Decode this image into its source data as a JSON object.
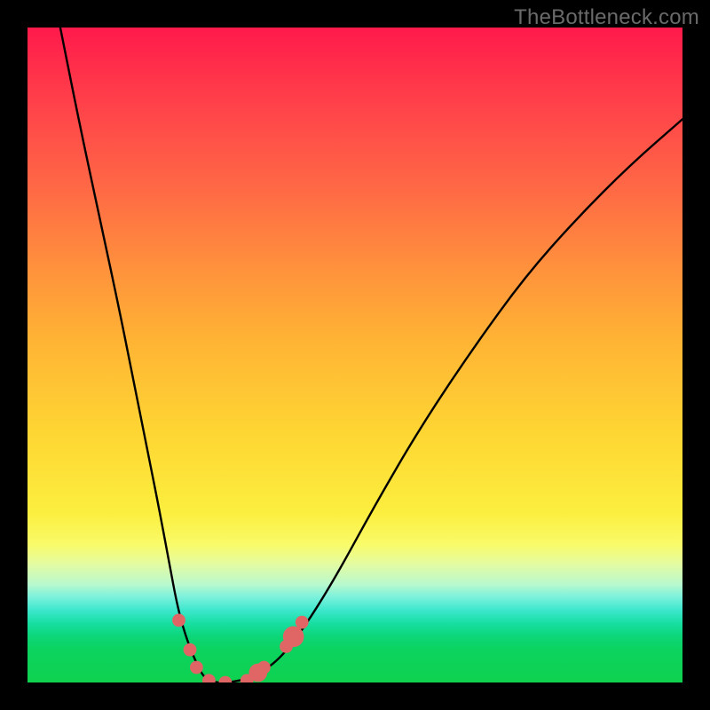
{
  "watermark": "TheBottleneck.com",
  "chart_data": {
    "type": "line",
    "title": "",
    "xlabel": "",
    "ylabel": "",
    "xlim": [
      0,
      100
    ],
    "ylim": [
      0,
      100
    ],
    "grid": false,
    "legend": false,
    "series": [
      {
        "name": "curve",
        "x": [
          5,
          8,
          11,
          14,
          16,
          18,
          20,
          21.5,
          23,
          24.5,
          26,
          27,
          28.5,
          31,
          34,
          38,
          42,
          47,
          53,
          60,
          68,
          76,
          84,
          92,
          100
        ],
        "y": [
          100,
          85,
          71,
          57,
          47,
          37,
          27,
          19,
          11,
          6,
          2.5,
          0.7,
          0,
          0,
          0.7,
          3,
          8,
          16,
          27,
          39,
          51,
          62,
          71,
          79,
          86
        ]
      }
    ],
    "markers": [
      {
        "x": 23.1,
        "y": 9.5,
        "r": 1.0
      },
      {
        "x": 24.8,
        "y": 5.0,
        "r": 1.0
      },
      {
        "x": 25.8,
        "y": 2.3,
        "r": 1.0
      },
      {
        "x": 27.7,
        "y": 0.3,
        "r": 1.0
      },
      {
        "x": 30.2,
        "y": 0.0,
        "r": 1.0
      },
      {
        "x": 33.5,
        "y": 0.3,
        "r": 1.0
      },
      {
        "x": 35.2,
        "y": 1.5,
        "r": 1.4
      },
      {
        "x": 36.1,
        "y": 2.3,
        "r": 1.0
      },
      {
        "x": 39.5,
        "y": 5.5,
        "r": 1.0
      },
      {
        "x": 40.6,
        "y": 7.0,
        "r": 1.6
      },
      {
        "x": 41.9,
        "y": 9.2,
        "r": 1.0
      }
    ],
    "colors": {
      "curve": "#000000",
      "marker": "#e06666"
    }
  }
}
